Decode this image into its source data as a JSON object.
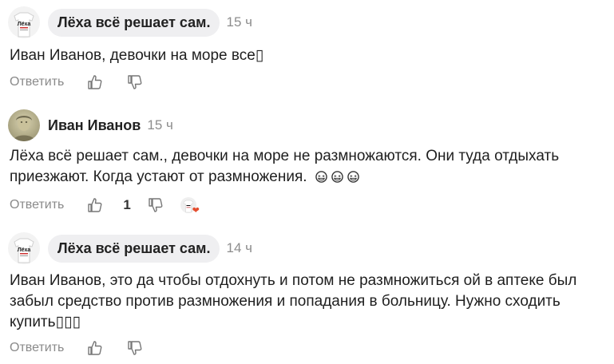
{
  "comments": [
    {
      "author": "Лёха всё решает сам.",
      "time": "15 ч",
      "text": "Иван Иванов, девочки на море все▯",
      "reply_label": "Ответить",
      "likes": ""
    },
    {
      "author": "Иван Иванов",
      "time": "15 ч",
      "text_line1": "Лёха всё решает сам., девочки на море не размножаются. Они туда отдыхать",
      "text_line2": "приезжают. Когда устают от размножения.",
      "reply_label": "Ответить",
      "likes": "1"
    },
    {
      "author": "Лёха всё решает сам.",
      "time": "14 ч",
      "text_line1": "Иван Иванов, это да чтобы отдохнуть и потом не размножиться ой в аптеке был",
      "text_line2": "забыл средство против размножения и попадания в больницу. Нужно сходить",
      "text_line3": "купить▯▯▯",
      "reply_label": "Ответить",
      "likes": ""
    }
  ],
  "avatar_shirt_text": "Лёха"
}
